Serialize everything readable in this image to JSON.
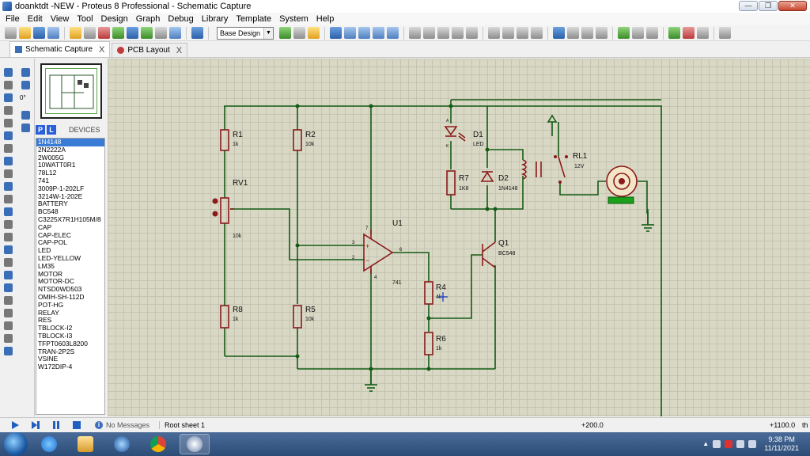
{
  "window": {
    "title": "doanktdt -NEW - Proteus 8 Professional - Schematic Capture"
  },
  "menu": [
    "File",
    "Edit",
    "View",
    "Tool",
    "Design",
    "Graph",
    "Debug",
    "Library",
    "Template",
    "System",
    "Help"
  ],
  "toolbar": {
    "design_select": "Base Design"
  },
  "tabs": [
    {
      "label": "Schematic Capture",
      "close": "X"
    },
    {
      "label": "PCB Layout",
      "close": "X"
    }
  ],
  "left": {
    "rotation": "0°"
  },
  "devices": {
    "p_button": "P",
    "l_button": "L",
    "header": "DEVICES",
    "items": [
      "1N4148",
      "2N2222A",
      "2W005G",
      "10WATT0R1",
      "78L12",
      "741",
      "3009P-1-202LF",
      "3214W-1-202E",
      "BATTERY",
      "BC548",
      "C3225X7R1H105M/8",
      "CAP",
      "CAP-ELEC",
      "CAP-POL",
      "LED",
      "LED-YELLOW",
      "LM35",
      "MOTOR",
      "MOTOR-DC",
      "NTSD0WD503",
      "OMIH-SH-112D",
      "POT-HG",
      "RELAY",
      "RES",
      "TBLOCK-I2",
      "TBLOCK-I3",
      "TFPT0603L8200",
      "TRAN-2P2S",
      "VSINE",
      "W172DIP-4"
    ],
    "selected": "1N4148"
  },
  "schematic": {
    "r1": {
      "ref": "R1",
      "value": "1k"
    },
    "r2": {
      "ref": "R2",
      "value": "10k"
    },
    "rv1": {
      "ref": "RV1",
      "value": "10k"
    },
    "r8": {
      "ref": "R8",
      "value": "1k"
    },
    "r5": {
      "ref": "R5",
      "value": "10k"
    },
    "u1": {
      "ref": "U1",
      "value": "741",
      "pin3": "3",
      "pin2": "2",
      "pin6": "6",
      "pin7": "7",
      "pin4": "4",
      "plus": "+",
      "minus": "−"
    },
    "d1": {
      "ref": "D1",
      "value": "LED",
      "a": "A",
      "k": "K"
    },
    "r7": {
      "ref": "R7",
      "value": "1K8"
    },
    "d2": {
      "ref": "D2",
      "value": "1N4148"
    },
    "rl1": {
      "ref": "RL1",
      "value": "12V"
    },
    "q1": {
      "ref": "Q1",
      "value": "BC548"
    },
    "r4": {
      "ref": "R4",
      "value": "4k"
    },
    "r6": {
      "ref": "R6",
      "value": "1k"
    }
  },
  "status": {
    "messages": "No Messages",
    "sheet": "Root sheet 1",
    "x": "+200.0",
    "y": "+1100.0",
    "unit": "th"
  },
  "clock": {
    "time": "9:38 PM",
    "date": "11/11/2021"
  }
}
